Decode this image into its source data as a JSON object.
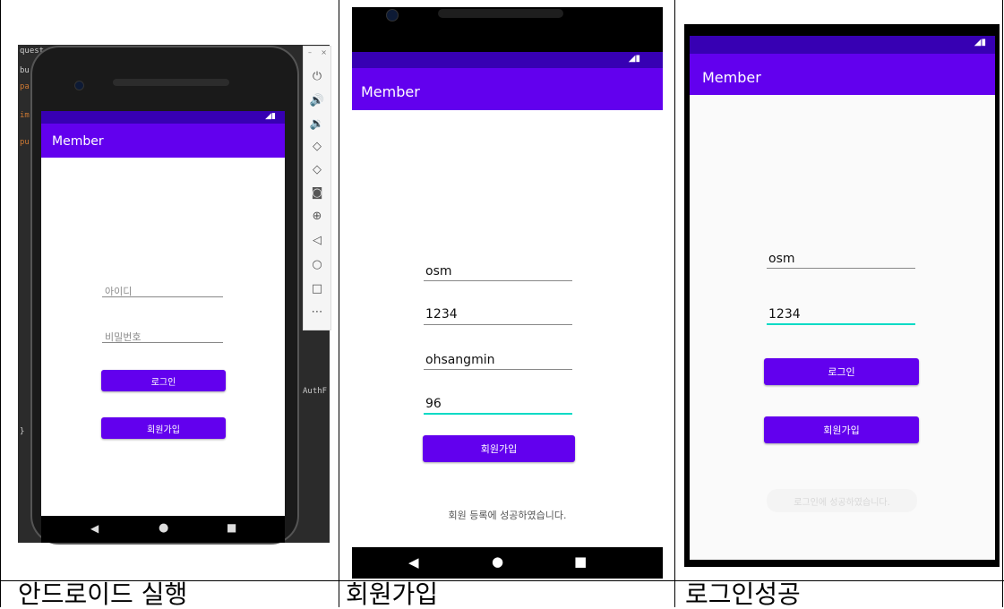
{
  "captions": [
    "안드로이드 실행",
    "회원가입",
    "로그인성공"
  ],
  "panel1": {
    "app_title": "Member",
    "id_hint": "아이디",
    "pw_hint": "비밀번호",
    "login_label": "로그인",
    "signup_label": "회원가입",
    "code_fragments": [
      "quest",
      "bu",
      "pa",
      "im",
      "pu",
      "AuthF",
      "}"
    ],
    "toolbar_icons": [
      "power-icon",
      "volume-up-icon",
      "volume-down-icon",
      "rotate-left-icon",
      "rotate-right-icon",
      "camera-icon",
      "zoom-icon",
      "back-icon",
      "home-icon",
      "overview-icon",
      "more-icon"
    ]
  },
  "panel2": {
    "app_title": "Member",
    "fields": [
      "osm",
      "1234",
      "ohsangmin",
      "96"
    ],
    "signup_label": "회원가입",
    "message": "회원 등록에 성공하였습니다."
  },
  "panel3": {
    "app_title": "Member",
    "fields": [
      "osm",
      "1234"
    ],
    "login_label": "로그인",
    "signup_label": "회원가입",
    "toast": "로그인에 성공하였습니다."
  },
  "colors": {
    "primary": "#6200ee",
    "status_bar": "#3700b3",
    "accent_underline": "#03dac5"
  }
}
